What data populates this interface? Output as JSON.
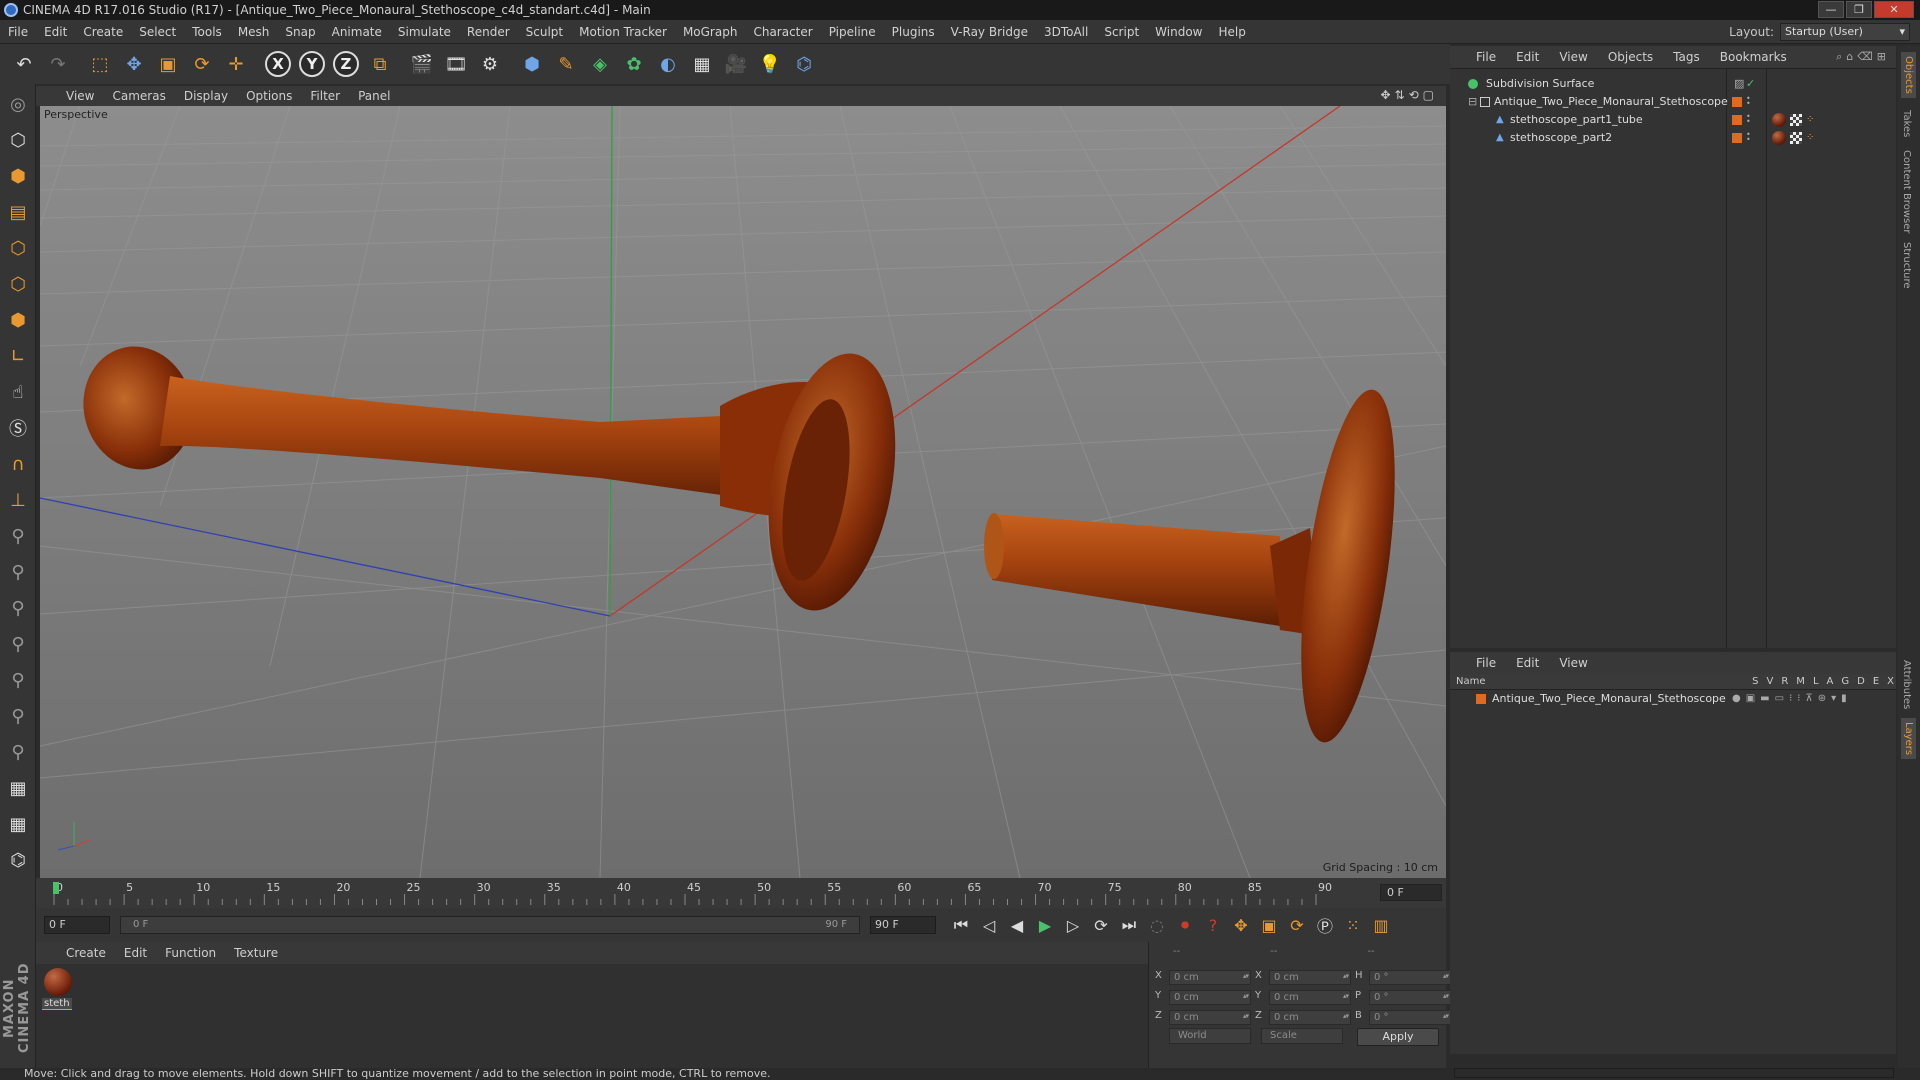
{
  "window": {
    "title": "CINEMA 4D R17.016 Studio (R17) - [Antique_Two_Piece_Monaural_Stethoscope_c4d_standart.c4d] - Main",
    "controls": [
      "—",
      "❐",
      "✕"
    ]
  },
  "menubar": {
    "items": [
      "File",
      "Edit",
      "Create",
      "Select",
      "Tools",
      "Mesh",
      "Snap",
      "Animate",
      "Simulate",
      "Render",
      "Sculpt",
      "Motion Tracker",
      "MoGraph",
      "Character",
      "Pipeline",
      "Plugins",
      "V-Ray Bridge",
      "3DToAll",
      "Script",
      "Window",
      "Help"
    ],
    "layout_label": "Layout:",
    "layout_value": "Startup (User)"
  },
  "toolbar": {
    "axis_x": "X",
    "axis_y": "Y",
    "axis_z": "Z"
  },
  "viewport": {
    "menu": [
      "View",
      "Cameras",
      "Display",
      "Options",
      "Filter",
      "Panel"
    ],
    "camera_label": "Perspective",
    "grid_spacing": "Grid Spacing : 10 cm",
    "colors": {
      "model": "#b04a12",
      "x_axis": "#c0392b",
      "y_axis": "#2ea043",
      "z_axis": "#3040b0"
    }
  },
  "timeline": {
    "ticks": [
      "0",
      "5",
      "10",
      "15",
      "20",
      "25",
      "30",
      "35",
      "40",
      "45",
      "50",
      "55",
      "60",
      "65",
      "70",
      "75",
      "80",
      "85",
      "90"
    ],
    "current_frame": "0 F"
  },
  "playback": {
    "start_field": "0 F",
    "slider_start": "0 F",
    "slider_end": "90 F",
    "end_field": "90 F"
  },
  "materials": {
    "menu": [
      "Create",
      "Edit",
      "Function",
      "Texture"
    ],
    "items": [
      {
        "name": "steth"
      }
    ]
  },
  "coordinates": {
    "header": [
      "--",
      "--",
      "--"
    ],
    "rows": [
      {
        "a": "X",
        "a_val": "0 cm",
        "b": "X",
        "b_val": "0 cm",
        "c": "H",
        "c_val": "0 °"
      },
      {
        "a": "Y",
        "a_val": "0 cm",
        "b": "Y",
        "b_val": "0 cm",
        "c": "P",
        "c_val": "0 °"
      },
      {
        "a": "Z",
        "a_val": "0 cm",
        "b": "Z",
        "b_val": "0 cm",
        "c": "B",
        "c_val": "0 °"
      }
    ],
    "mode": "World",
    "transform": "Scale",
    "apply": "Apply"
  },
  "objects": {
    "menu": [
      "File",
      "Edit",
      "View",
      "Objects",
      "Tags",
      "Bookmarks"
    ],
    "tree": [
      {
        "name": "Subdivision Surface"
      },
      {
        "name": "Antique_Two_Piece_Monaural_Stethoscope"
      },
      {
        "name": "stethoscope_part1_tube"
      },
      {
        "name": "stethoscope_part2"
      }
    ]
  },
  "layers": {
    "menu": [
      "File",
      "Edit",
      "View"
    ],
    "name_header": "Name",
    "columns": [
      "S",
      "V",
      "R",
      "M",
      "L",
      "A",
      "G",
      "D",
      "E",
      "X"
    ],
    "items": [
      {
        "name": "Antique_Two_Piece_Monaural_Stethoscope"
      }
    ]
  },
  "side_tabs": [
    "Objects",
    "Takes",
    "Content Browser",
    "Structure",
    "Attributes",
    "Layers"
  ],
  "status": "Move: Click and drag to move elements. Hold down SHIFT to quantize movement / add to the selection in point mode, CTRL to remove.",
  "branding": "MAXON CINEMA 4D"
}
